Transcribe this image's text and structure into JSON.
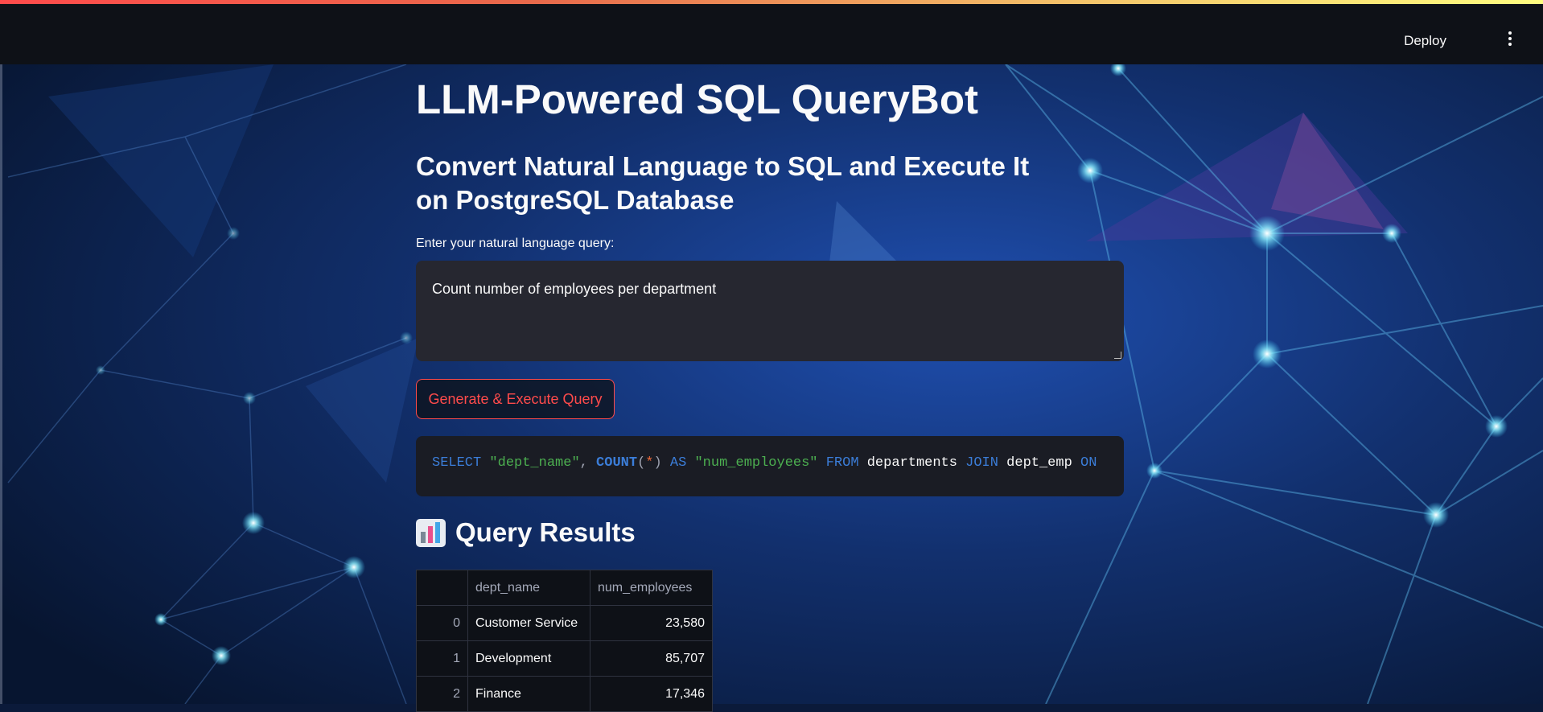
{
  "header": {
    "deploy_label": "Deploy",
    "menu_icon": "vertical-ellipsis-icon"
  },
  "page": {
    "title": "LLM-Powered SQL QueryBot",
    "subtitle": "Convert Natural Language to SQL and Execute It on PostgreSQL Database",
    "query_label": "Enter your natural language query:",
    "query_value": "Count number of employees per department",
    "button_label": "Generate & Execute Query"
  },
  "sql": {
    "tokens": [
      {
        "t": "SELECT",
        "c": "kw"
      },
      {
        "t": " ",
        "c": "pl"
      },
      {
        "t": "\"dept_name\"",
        "c": "str"
      },
      {
        "t": ",",
        "c": "pn"
      },
      {
        "t": " ",
        "c": "pl"
      },
      {
        "t": "COUNT",
        "c": "fn"
      },
      {
        "t": "(",
        "c": "pn"
      },
      {
        "t": "*",
        "c": "op"
      },
      {
        "t": ")",
        "c": "pn"
      },
      {
        "t": " ",
        "c": "pl"
      },
      {
        "t": "AS",
        "c": "kw"
      },
      {
        "t": " ",
        "c": "pl"
      },
      {
        "t": "\"num_employees\"",
        "c": "str"
      },
      {
        "t": " ",
        "c": "pl"
      },
      {
        "t": "FROM",
        "c": "kw"
      },
      {
        "t": " departments ",
        "c": "pl"
      },
      {
        "t": "JOIN",
        "c": "kw"
      },
      {
        "t": " dept_emp ",
        "c": "pl"
      },
      {
        "t": "ON",
        "c": "kw"
      }
    ]
  },
  "results": {
    "icon": "bar-chart-icon",
    "heading": "Query Results",
    "columns": [
      "dept_name",
      "num_employees"
    ],
    "rows": [
      {
        "index": "0",
        "dept_name": "Customer Service",
        "num_employees": "23,580"
      },
      {
        "index": "1",
        "dept_name": "Development",
        "num_employees": "85,707"
      },
      {
        "index": "2",
        "dept_name": "Finance",
        "num_employees": "17,346"
      }
    ]
  },
  "colors": {
    "accent": "#ff4b4b",
    "header_bg": "#0e1117",
    "input_bg": "#262730",
    "keyword": "#3b7dd8",
    "string": "#4caf50"
  }
}
